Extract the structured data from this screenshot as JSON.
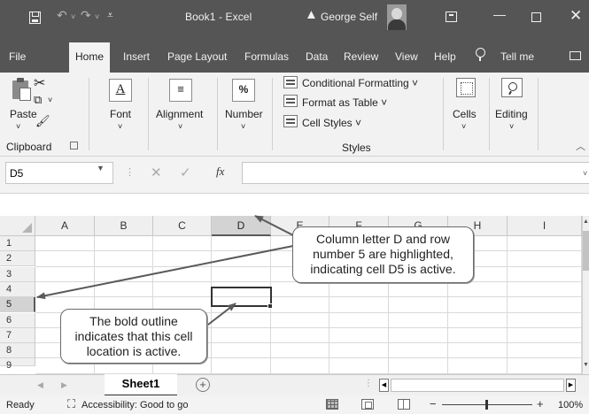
{
  "titlebar": {
    "doc_title": "Book1 - Excel",
    "user_name": "George Self",
    "icons": [
      "save-icon",
      "undo-icon",
      "redo-icon",
      "customize-qat-icon",
      "warning-icon",
      "ribbon-display-icon",
      "minimize-icon",
      "maximize-icon",
      "close-icon"
    ]
  },
  "tabs": [
    "File",
    "Home",
    "Insert",
    "Page Layout",
    "Formulas",
    "Data",
    "Review",
    "View",
    "Help",
    "Tell me"
  ],
  "active_tab": "Home",
  "ribbon": {
    "paste": "Paste",
    "clipboard": "Clipboard",
    "font": "Font",
    "font_glyph": "A",
    "alignment": "Alignment",
    "alignment_glyph": "≡",
    "number": "Number",
    "number_glyph": "%",
    "conditional_formatting": "Conditional Formatting ˅",
    "format_as_table": "Format as Table ˅",
    "cell_styles": "Cell Styles ˅",
    "styles": "Styles",
    "cells": "Cells",
    "editing": "Editing"
  },
  "formula_bar": {
    "name_box": "D5",
    "fx": "fx",
    "formula": ""
  },
  "grid": {
    "columns": [
      "A",
      "B",
      "C",
      "D",
      "E",
      "F",
      "G",
      "H",
      "I"
    ],
    "rows": [
      "1",
      "2",
      "3",
      "4",
      "5",
      "6",
      "7",
      "8",
      "9"
    ],
    "selected_column": "D",
    "selected_row": "5",
    "active_cell": "D5"
  },
  "callouts": {
    "top": [
      "Column letter D and row",
      "number 5 are highlighted,",
      "indicating cell D5 is active."
    ],
    "bottom": [
      "The bold outline",
      "indicates that this cell",
      "location is active."
    ]
  },
  "sheets": [
    "Sheet1"
  ],
  "add_sheet": "+",
  "status": {
    "ready": "Ready",
    "accessibility": "Accessibility: Good to go",
    "zoom": "100%",
    "zoom_minus": "−",
    "zoom_plus": "+"
  }
}
